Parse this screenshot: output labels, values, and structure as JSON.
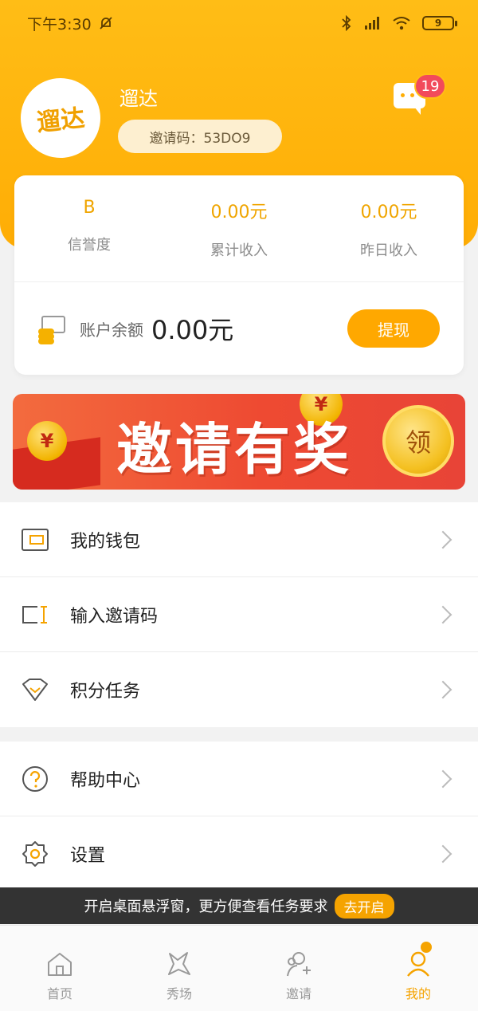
{
  "status_bar": {
    "time": "下午3:30",
    "battery": "9"
  },
  "profile": {
    "avatar_text": "遛达",
    "name": "遛达",
    "invite_code_label": "邀请码：53DO9",
    "message_badge": "19"
  },
  "stats": [
    {
      "value": "B",
      "label": "信誉度"
    },
    {
      "value": "0.00元",
      "label": "累计收入"
    },
    {
      "value": "0.00元",
      "label": "昨日收入"
    }
  ],
  "balance": {
    "label": "账户余额",
    "amount": "0.00元",
    "withdraw_label": "提现"
  },
  "banner": {
    "text": "邀请有奖",
    "button": "领"
  },
  "menu_group_1": [
    {
      "icon": "wallet-icon",
      "label": "我的钱包"
    },
    {
      "icon": "invite-code-icon",
      "label": "输入邀请码"
    },
    {
      "icon": "points-task-icon",
      "label": "积分任务"
    }
  ],
  "menu_group_2": [
    {
      "icon": "help-icon",
      "label": "帮助中心"
    },
    {
      "icon": "settings-icon",
      "label": "设置"
    }
  ],
  "notice": {
    "text": "开启桌面悬浮窗，更方便查看任务要求",
    "action": "去开启"
  },
  "tabs": [
    {
      "icon": "home-icon",
      "label": "首页"
    },
    {
      "icon": "showcase-icon",
      "label": "秀场"
    },
    {
      "icon": "invite-icon",
      "label": "邀请"
    },
    {
      "icon": "profile-icon",
      "label": "我的",
      "active": true
    }
  ],
  "colors": {
    "brand": "#FFAD05",
    "accent": "#F5A300",
    "badge": "#F24A5B"
  }
}
